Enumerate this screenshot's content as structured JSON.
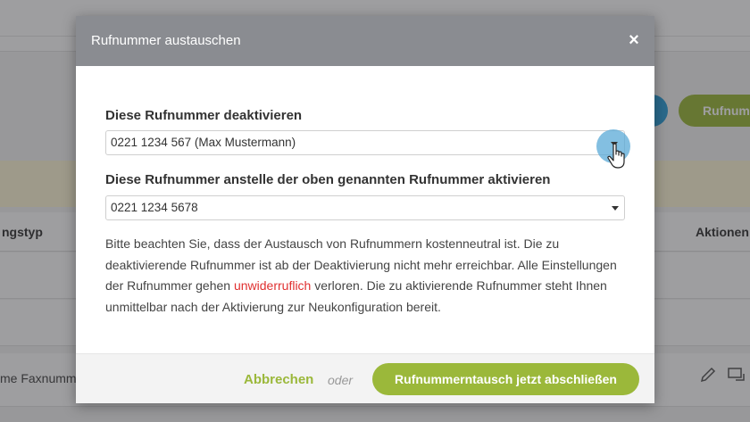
{
  "background": {
    "button_label": "Rufnumm",
    "table_header_left": "ngstyp",
    "table_header_right": "Aktionen",
    "row_text": "me Faxnumm"
  },
  "modal": {
    "title": "Rufnummer austauschen",
    "close_icon": "×",
    "deactivate_label": "Diese Rufnummer deaktivieren",
    "deactivate_value": "0221 1234 567 (Max Mustermann)",
    "activate_label": "Diese Rufnummer anstelle der oben genannten Rufnummer aktivieren",
    "activate_value": "0221 1234 5678",
    "info_part1": "Bitte beachten Sie, dass der Austausch von Rufnummern kostenneutral ist. Die zu deaktivierende Rufnummer ist ab der Deaktivierung nicht mehr erreichbar. Alle Einstellungen der Rufnummer gehen ",
    "info_warn": "unwiderruflich",
    "info_part2": " verloren. Die zu aktivierende Rufnummer steht Ihnen unmittelbar nach der Aktivierung zur Neukonfiguration bereit.",
    "cancel_label": "Abbrechen",
    "or_label": "oder",
    "confirm_label": "Rufnummerntausch jetzt abschließen"
  },
  "colors": {
    "accent_green": "#9bb83a",
    "header_gray": "#8a8c91",
    "warning_red": "#e03030",
    "highlight_blue": "#5aaad7"
  },
  "icons": [
    "close-icon",
    "dropdown-caret-icon",
    "hand-cursor-icon",
    "pencil-icon",
    "swap-icon"
  ]
}
